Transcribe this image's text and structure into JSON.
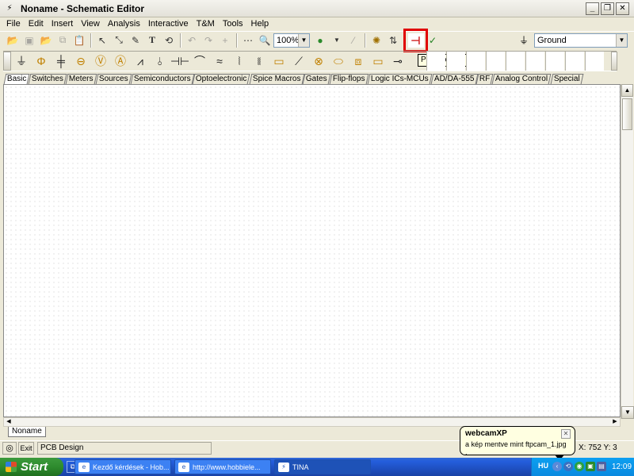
{
  "window": {
    "title": "Noname - Schematic Editor"
  },
  "menu": {
    "items": [
      "File",
      "Edit",
      "Insert",
      "View",
      "Analysis",
      "Interactive",
      "T&M",
      "Tools",
      "Help"
    ]
  },
  "toolbar": {
    "zoom_value": "100%",
    "ground_select_value": "Ground",
    "tooltip": "PCB Design"
  },
  "component_tabs": [
    "Basic",
    "Switches",
    "Meters",
    "Sources",
    "Semiconductors",
    "Optoelectronic",
    "Spice Macros",
    "Gates",
    "Flip-flops",
    "Logic ICs-MCUs",
    "AD/DA-555",
    "RF",
    "Analog Control",
    "Special"
  ],
  "sheet": {
    "tab_label": "Noname"
  },
  "statusbar": {
    "exit_label": "Exit",
    "text": "PCB Design",
    "coords": "X: 752  Y: 3"
  },
  "balloon": {
    "title": "webcamXP",
    "text": "a kép mentve mint ftpcam_1.jpg ."
  },
  "taskbar": {
    "start_label": "Start",
    "tasks": [
      "Kezdő kérdések - Hob...",
      "http://www.hobbiele...",
      "TINA"
    ],
    "tray_lang": "HU",
    "clock": "12:09"
  }
}
